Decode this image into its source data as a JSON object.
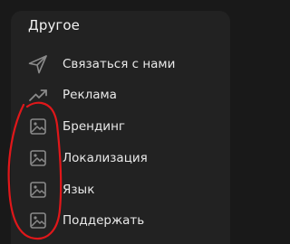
{
  "section": {
    "title": "Другое"
  },
  "menu": {
    "items": [
      {
        "label": "Связаться с нами",
        "icon": "send-icon"
      },
      {
        "label": "Реклама",
        "icon": "trending-up-icon"
      },
      {
        "label": "Брендинг",
        "icon": "image-icon"
      },
      {
        "label": "Локализация",
        "icon": "image-icon"
      },
      {
        "label": "Язык",
        "icon": "image-icon"
      },
      {
        "label": "Поддержать",
        "icon": "image-icon"
      }
    ]
  },
  "colors": {
    "background": "#191919",
    "panel": "#222222",
    "text": "#e9e9e9",
    "icon": "#8a8a8a",
    "annotation": "#e0171a"
  }
}
